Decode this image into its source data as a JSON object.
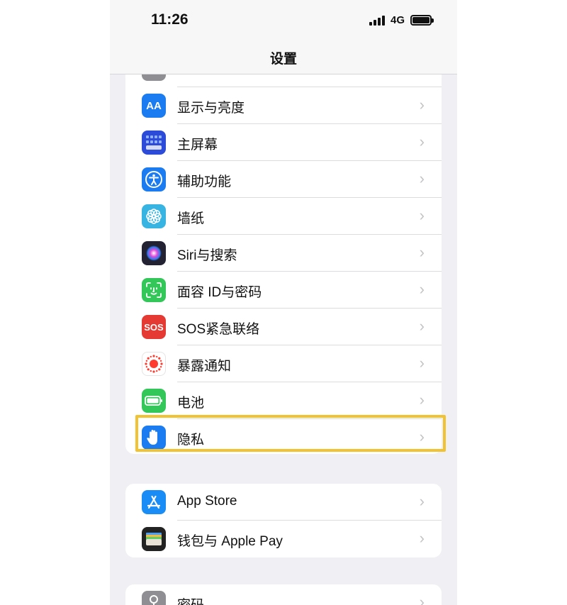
{
  "status": {
    "time": "11:26",
    "network": "4G"
  },
  "nav": {
    "title": "设置"
  },
  "group1": {
    "items": [
      {
        "label": "显示与亮度",
        "icon": "display-brightness-icon",
        "color": "#1a7cf0"
      },
      {
        "label": "主屏幕",
        "icon": "home-screen-icon",
        "color": "#2c4bd8"
      },
      {
        "label": "辅助功能",
        "icon": "accessibility-icon",
        "color": "#1a7cf0"
      },
      {
        "label": "墙纸",
        "icon": "wallpaper-icon",
        "color": "#38b4e3"
      },
      {
        "label": "Siri与搜索",
        "icon": "siri-icon",
        "color": "#222233"
      },
      {
        "label": "面容 ID与密码",
        "icon": "face-id-icon",
        "color": "#33c759"
      },
      {
        "label": "SOS紧急联络",
        "icon": "sos-icon",
        "color": "#e53a33",
        "icon_text": "SOS"
      },
      {
        "label": "暴露通知",
        "icon": "exposure-notification-icon",
        "color": "#ffffff"
      },
      {
        "label": "电池",
        "icon": "battery-icon",
        "color": "#33c759"
      },
      {
        "label": "隐私",
        "icon": "privacy-hand-icon",
        "color": "#1a7cf0"
      }
    ]
  },
  "group2": {
    "items": [
      {
        "label": "App Store",
        "icon": "app-store-icon",
        "color": "#1a8cf5"
      },
      {
        "label": "钱包与 Apple Pay",
        "icon": "wallet-icon",
        "color": "#222222"
      }
    ]
  },
  "group3": {
    "items": [
      {
        "label": "密码",
        "icon": "key-icon",
        "color": "#8e8e93"
      }
    ]
  },
  "highlight_color": "#f1c232"
}
